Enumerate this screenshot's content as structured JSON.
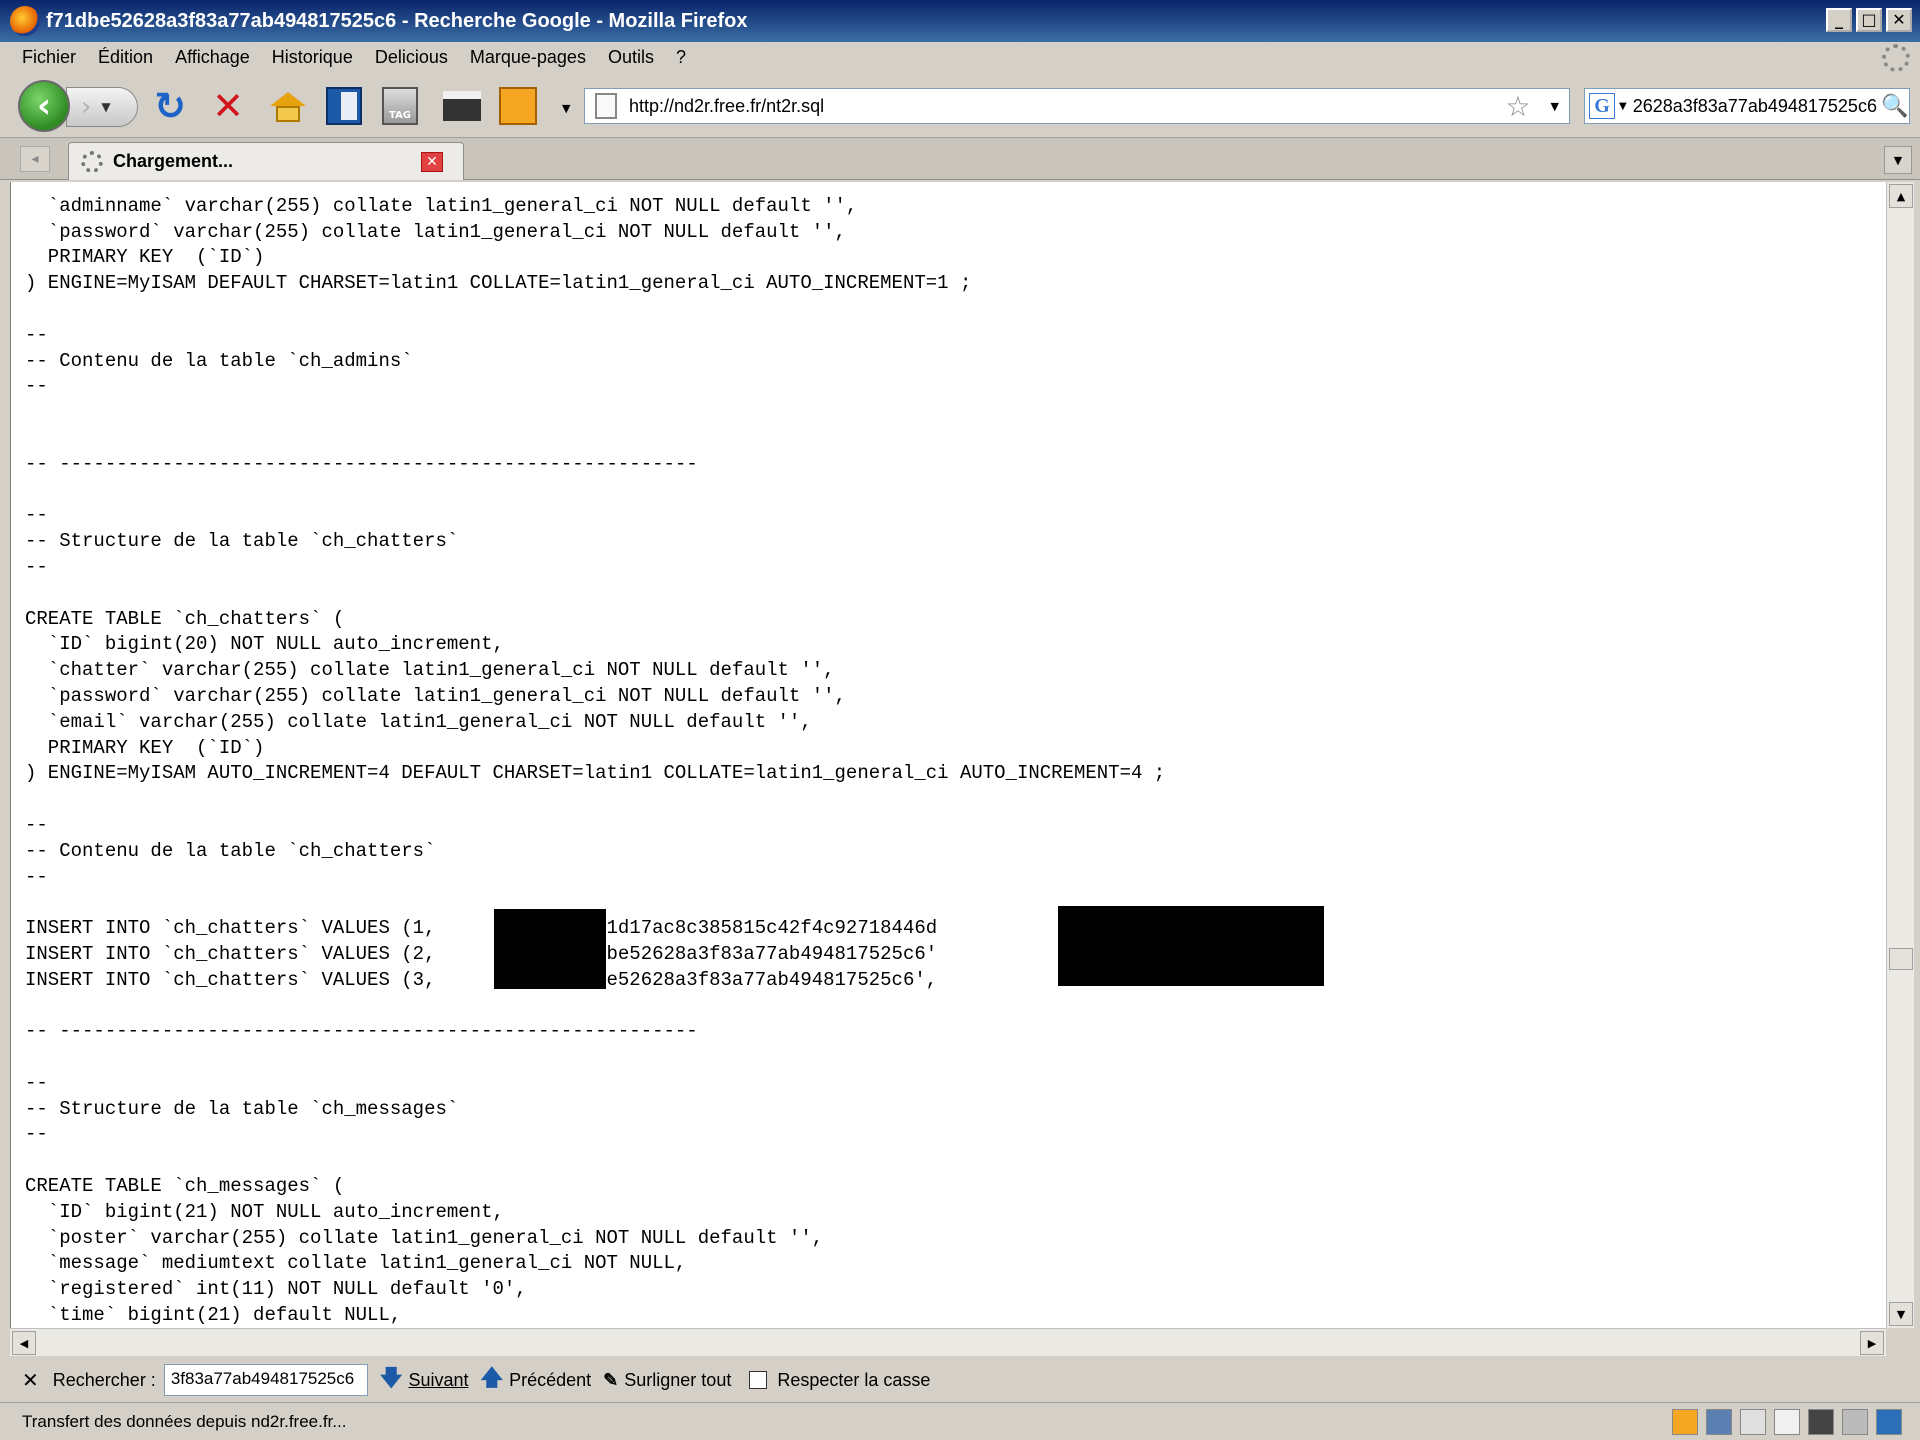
{
  "window": {
    "title": "f71dbe52628a3f83a77ab494817525c6 - Recherche Google - Mozilla Firefox",
    "minimize": "_",
    "maximize": "□",
    "close": "✕"
  },
  "menu": [
    "Fichier",
    "Édition",
    "Affichage",
    "Historique",
    "Delicious",
    "Marque-pages",
    "Outils",
    "?"
  ],
  "toolbar": {
    "back": "‹",
    "forward": "›",
    "reload": "↻",
    "stop": "✕",
    "tag_label": "TAG"
  },
  "urlbar": {
    "url": "http://nd2r.free.fr/nt2r.sql",
    "star": "☆"
  },
  "searchbar": {
    "engine": "G",
    "value": "2628a3f83a77ab494817525c6"
  },
  "tab": {
    "label": "Chargement...",
    "close": "✕"
  },
  "content": {
    "sql_lines": [
      "",
      "  `adminname` varchar(255) collate latin1_general_ci NOT NULL default '',",
      "  `password` varchar(255) collate latin1_general_ci NOT NULL default '',",
      "  PRIMARY KEY  (`ID`)",
      ") ENGINE=MyISAM DEFAULT CHARSET=latin1 COLLATE=latin1_general_ci AUTO_INCREMENT=1 ;",
      "",
      "--",
      "-- Contenu de la table `ch_admins`",
      "--",
      "",
      "",
      "-- --------------------------------------------------------",
      "",
      "--",
      "-- Structure de la table `ch_chatters`",
      "--",
      "",
      "CREATE TABLE `ch_chatters` (",
      "  `ID` bigint(20) NOT NULL auto_increment,",
      "  `chatter` varchar(255) collate latin1_general_ci NOT NULL default '',",
      "  `password` varchar(255) collate latin1_general_ci NOT NULL default '',",
      "  `email` varchar(255) collate latin1_general_ci NOT NULL default '',",
      "  PRIMARY KEY  (`ID`)",
      ") ENGINE=MyISAM AUTO_INCREMENT=4 DEFAULT CHARSET=latin1 COLLATE=latin1_general_ci AUTO_INCREMENT=4 ;",
      "",
      "--",
      "-- Contenu de la table `ch_chatters`",
      "--",
      "",
      "INSERT INTO `ch_chatters` VALUES (1,         re', '1d17ac8c385815c42f4c92718446d                    t@free.fr');",
      "INSERT INTO `ch_chatters` VALUES (2,          'f71dbe52628a3f83a77ab494817525c6'",
      "INSERT INTO `ch_chatters` VALUES (3,         'f71dbe52628a3f83a77ab494817525c6',",
      "",
      "-- --------------------------------------------------------",
      "",
      "--",
      "-- Structure de la table `ch_messages`",
      "--",
      "",
      "CREATE TABLE `ch_messages` (",
      "  `ID` bigint(21) NOT NULL auto_increment,",
      "  `poster` varchar(255) collate latin1_general_ci NOT NULL default '',",
      "  `message` mediumtext collate latin1_general_ci NOT NULL,",
      "  `registered` int(11) NOT NULL default '0',",
      "  `time` bigint(21) default NULL,"
    ]
  },
  "findbar": {
    "close": "✕",
    "label": "Rechercher :",
    "value": "3f83a77ab494817525c6",
    "next": "Suivant",
    "previous": "Précédent",
    "highlight": "Surligner tout",
    "match_case": "Respecter la casse"
  },
  "status": {
    "text": "Transfert des données depuis nd2r.free.fr..."
  }
}
